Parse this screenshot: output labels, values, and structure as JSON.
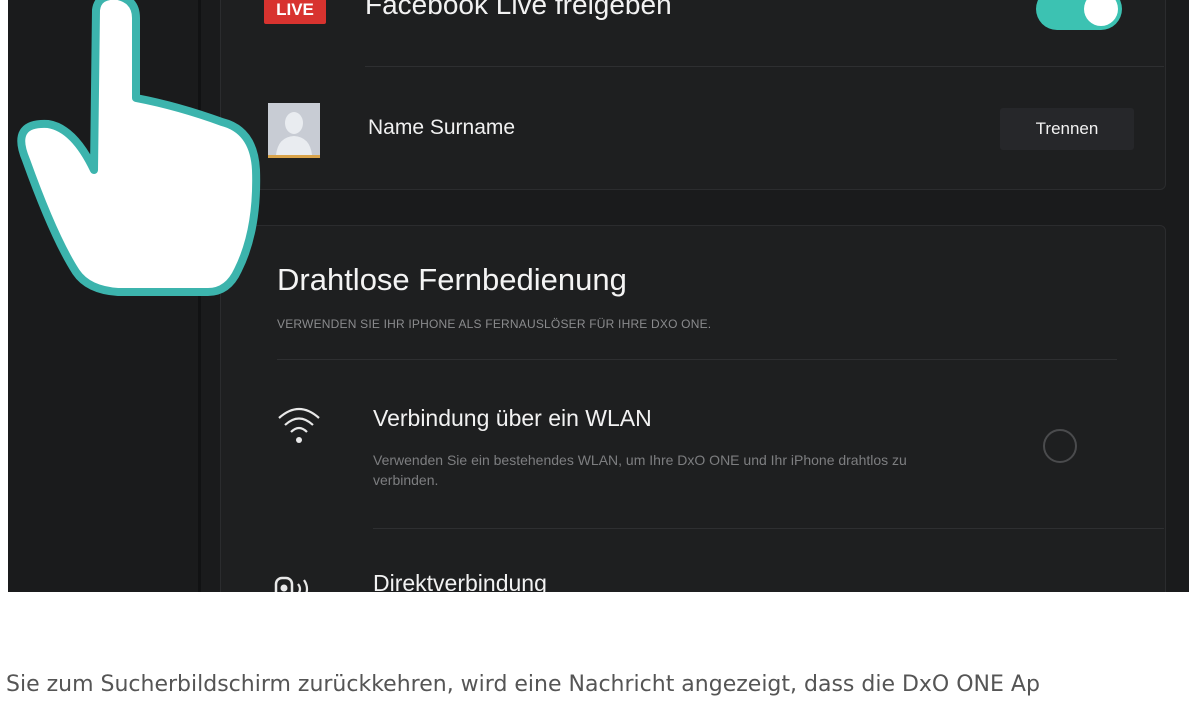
{
  "facebook_live": {
    "badge": "LIVE",
    "title": "Facebook Live freigeben",
    "toggle_state": "on",
    "accent_color": "#3cc2b2",
    "badge_color": "#d8332f"
  },
  "account": {
    "name": "Name Surname",
    "disconnect_label": "Trennen",
    "avatar_icon": "user-silhouette-icon"
  },
  "remote": {
    "title": "Drahtlose Fernbedienung",
    "subtitle": "VERWENDEN SIE IHR IPHONE ALS FERNAUSLÖSER FÜR IHRE DXO ONE.",
    "options": [
      {
        "icon": "wifi-icon",
        "title": "Verbindung über ein WLAN",
        "description": "Verwenden Sie ein bestehendes WLAN, um Ihre DxO ONE und Ihr iPhone drahtlos zu verbinden.",
        "selected": false
      },
      {
        "icon": "direct-connection-icon",
        "title": "Direktverbindung"
      }
    ]
  },
  "overlay": {
    "icon": "pointing-hand-icon"
  },
  "caption": "Sie zum Sucherbildschirm zurückkehren, wird eine Nachricht angezeigt, dass die DxO ONE Ap"
}
